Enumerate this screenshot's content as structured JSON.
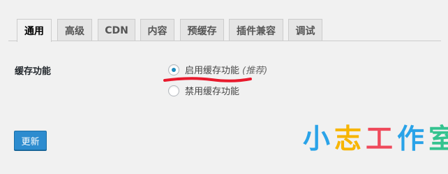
{
  "tabs": [
    "通用",
    "高级",
    "CDN",
    "内容",
    "预缓存",
    "插件兼容",
    "调试"
  ],
  "active_tab": 0,
  "setting": {
    "label": "缓存功能",
    "options": [
      {
        "label": "启用缓存功能",
        "hint": "(推荐)",
        "checked": true
      },
      {
        "label": "禁用缓存功能",
        "hint": "",
        "checked": false
      }
    ]
  },
  "update_button": "更新",
  "watermark": {
    "chars": [
      "小",
      "志",
      "工",
      "作",
      "室"
    ],
    "colors": [
      "#2aa3e8",
      "#f7b500",
      "#ef4a5b",
      "#2aa3e8",
      "#34c38f"
    ]
  },
  "annotation_color": "#e8192c"
}
